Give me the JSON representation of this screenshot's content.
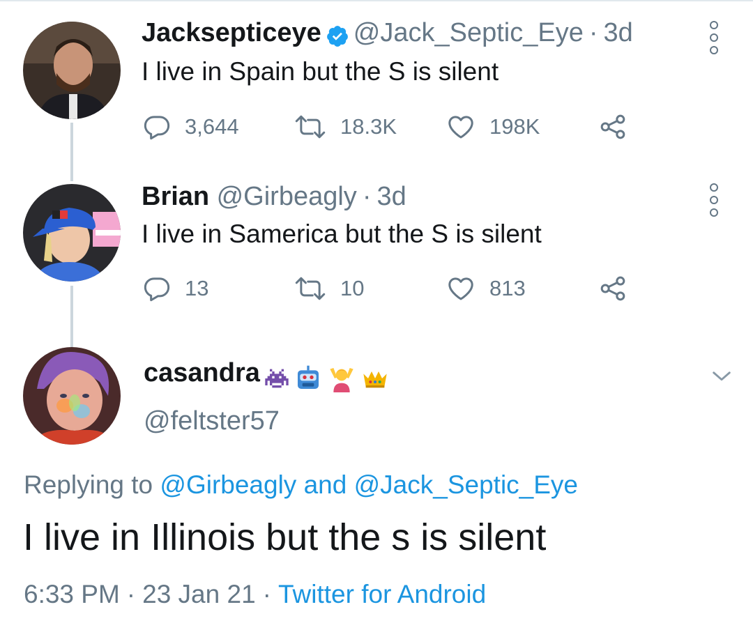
{
  "tweets": [
    {
      "name": "Jacksepticeye",
      "handle": "@Jack_Septic_Eye",
      "time": "3d",
      "text": "I live in Spain but the S is silent",
      "verified": true,
      "replies": "3,644",
      "retweets": "18.3K",
      "likes": "198K"
    },
    {
      "name": "Brian",
      "handle": "@Girbeagly",
      "time": "3d",
      "text": "I live in Samerica but the S is silent",
      "replies": "13",
      "retweets": "10",
      "likes": "813"
    }
  ],
  "main": {
    "name": "casandra",
    "name_emoji": [
      "alien-monster",
      "robot",
      "person-gesturing-ok",
      "crown"
    ],
    "handle": "@feltster57",
    "replying_prefix": "Replying to",
    "replying_user1": "@Girbeagly",
    "replying_and": "and",
    "replying_user2": "@Jack_Septic_Eye",
    "text": "I live in Illinois but the s is silent",
    "time": "6:33 PM",
    "date": "23 Jan 21",
    "source": "Twitter for Android"
  },
  "separator": "·",
  "colors": {
    "text": "#14171a",
    "secondary": "#657786",
    "link": "#1b95e0",
    "verified": "#1da1f2",
    "thread_line": "#ccd6dd"
  },
  "icons": [
    "reply-icon",
    "retweet-icon",
    "like-icon",
    "share-icon",
    "more-icon",
    "chevron-down-icon",
    "verified-badge-icon"
  ]
}
